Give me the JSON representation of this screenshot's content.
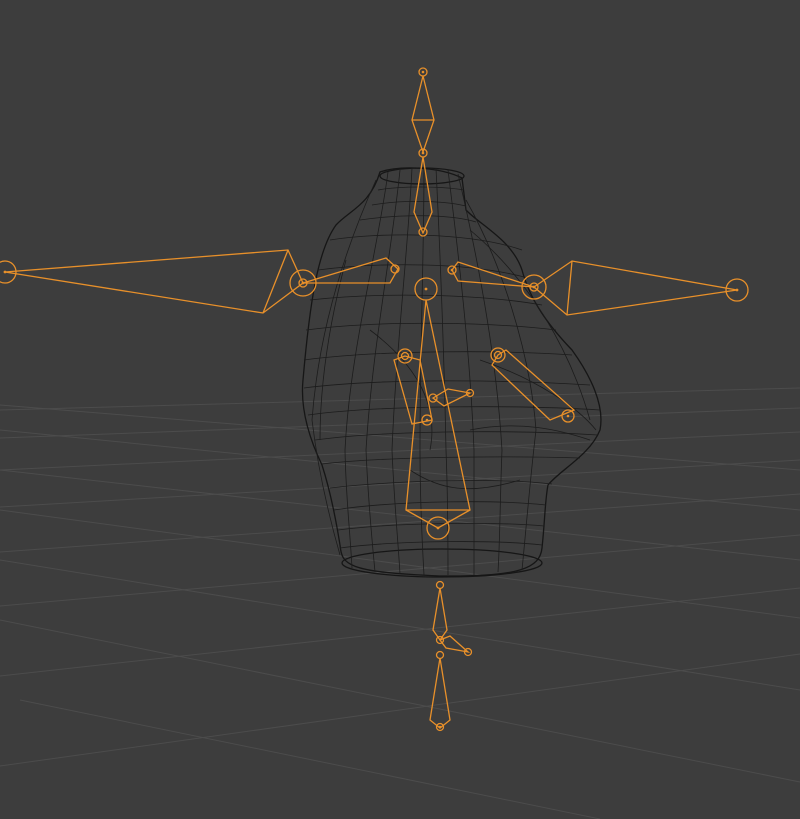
{
  "viewport": {
    "mode": "wireframe",
    "object": "torso-mesh",
    "armature": "armature",
    "colors": {
      "background": "#3d3d3d",
      "grid": "#4c4c4c",
      "wire": "#1c1c1c",
      "bone_selected": "#e8902a"
    },
    "icons": {
      "joint": "bone-joint-circle",
      "bone": "octahedral-bone"
    }
  }
}
